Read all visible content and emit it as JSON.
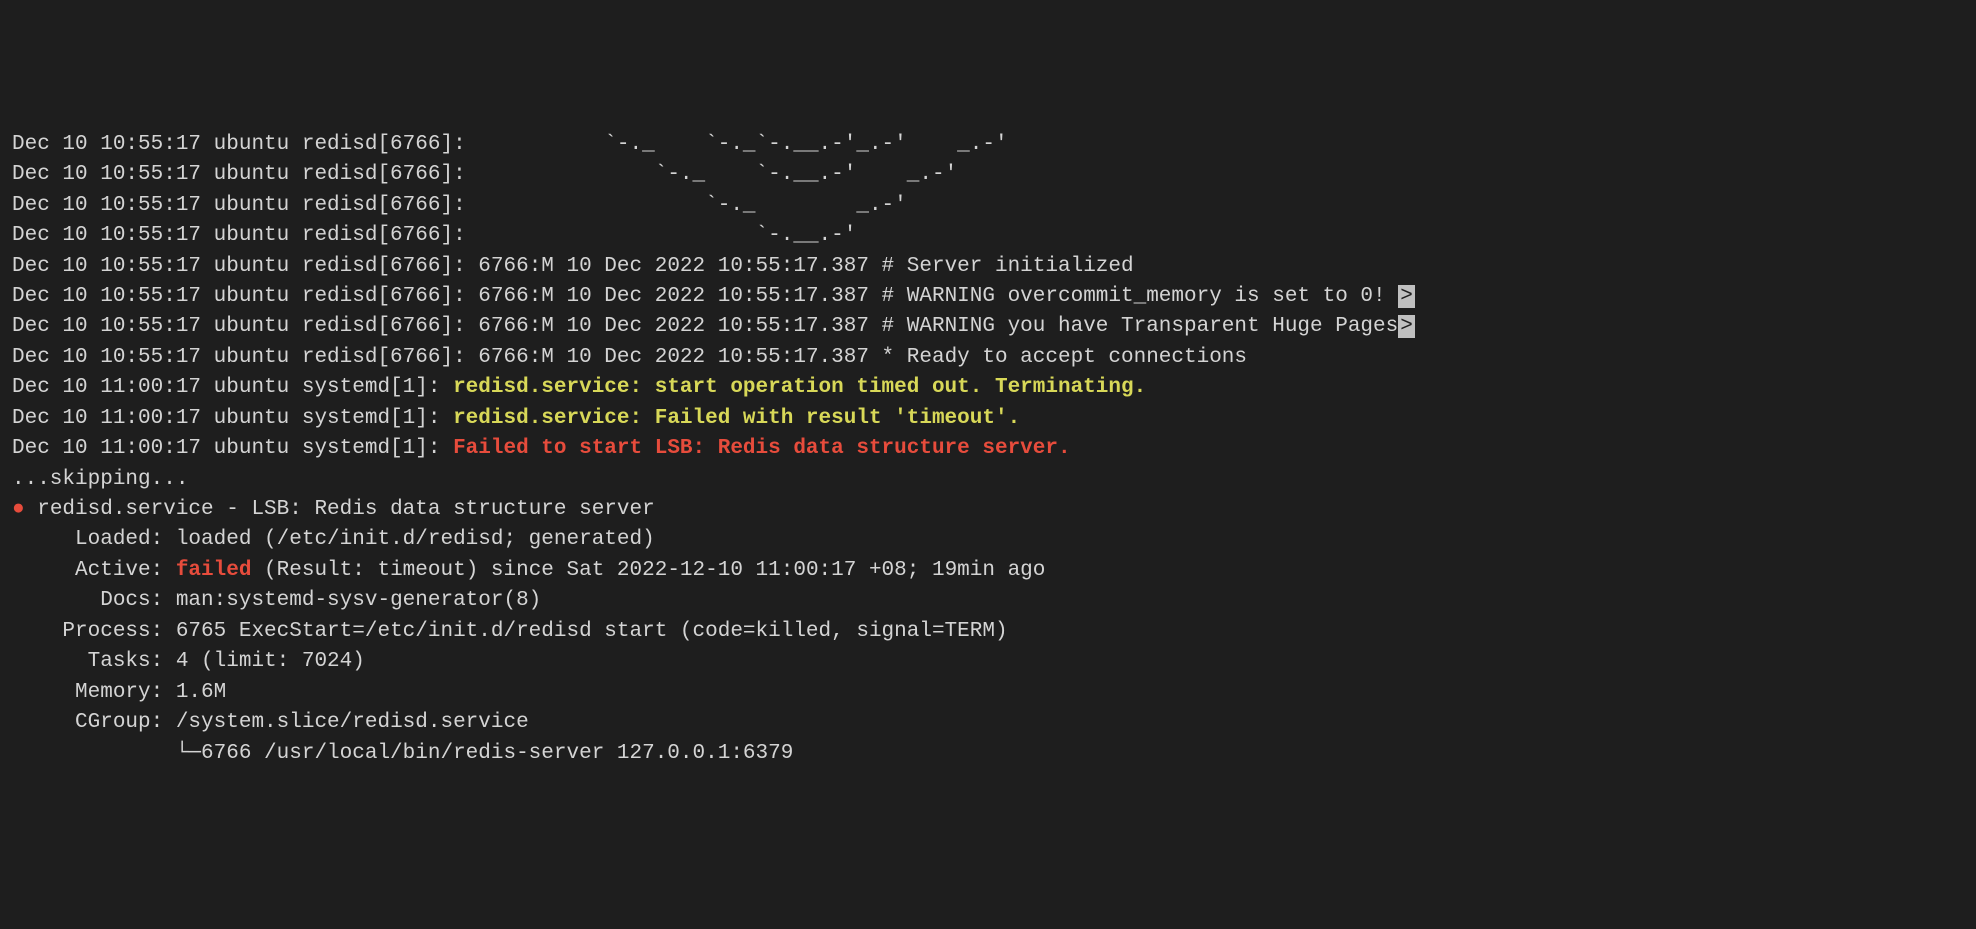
{
  "log": {
    "lines": [
      {
        "prefix": "Dec 10 10:55:17 ubuntu redisd[6766]:",
        "msg": "           `-._    `-._`-.__.-'_.-'    _.-'"
      },
      {
        "prefix": "Dec 10 10:55:17 ubuntu redisd[6766]:",
        "msg": "               `-._    `-.__.-'    _.-'"
      },
      {
        "prefix": "Dec 10 10:55:17 ubuntu redisd[6766]:",
        "msg": "                   `-._        _.-'"
      },
      {
        "prefix": "Dec 10 10:55:17 ubuntu redisd[6766]:",
        "msg": "                       `-.__.-'"
      },
      {
        "prefix": "Dec 10 10:55:17 ubuntu redisd[6766]:",
        "msg": " 6766:M 10 Dec 2022 10:55:17.387 # Server initialized"
      },
      {
        "prefix": "Dec 10 10:55:17 ubuntu redisd[6766]:",
        "msg": " 6766:M 10 Dec 2022 10:55:17.387 # WARNING overcommit_memory is set to 0! ",
        "scroll": ">"
      },
      {
        "prefix": "Dec 10 10:55:17 ubuntu redisd[6766]:",
        "msg": " 6766:M 10 Dec 2022 10:55:17.387 # WARNING you have Transparent Huge Pages",
        "scroll": ">"
      },
      {
        "prefix": "Dec 10 10:55:17 ubuntu redisd[6766]:",
        "msg": " 6766:M 10 Dec 2022 10:55:17.387 * Ready to accept connections"
      },
      {
        "prefix": "Dec 10 11:00:17 ubuntu systemd[1]: ",
        "highlight": "redisd.service: start operation timed out. Terminating.",
        "hclass": "yellow"
      },
      {
        "prefix": "Dec 10 11:00:17 ubuntu systemd[1]: ",
        "highlight": "redisd.service: Failed with result 'timeout'.",
        "hclass": "yellow"
      },
      {
        "prefix": "Dec 10 11:00:17 ubuntu systemd[1]: ",
        "highlight": "Failed to start LSB: Redis data structure server.",
        "hclass": "red"
      }
    ],
    "skipping": "...skipping..."
  },
  "status": {
    "bullet": "●",
    "header": " redisd.service - LSB: Redis data structure server",
    "loaded_label": "     Loaded: ",
    "loaded_value": "loaded (/etc/init.d/redisd; generated)",
    "active_label": "     Active: ",
    "active_state": "failed",
    "active_rest": " (Result: timeout) since Sat 2022-12-10 11:00:17 +08; 19min ago",
    "docs_label": "       Docs: ",
    "docs_value": "man:systemd-sysv-generator(8)",
    "process_label": "    Process: ",
    "process_value": "6765 ExecStart=/etc/init.d/redisd start (code=killed, signal=TERM)",
    "tasks_label": "      Tasks: ",
    "tasks_value": "4 (limit: 7024)",
    "memory_label": "     Memory: ",
    "memory_value": "1.6M",
    "cgroup_label": "     CGroup: ",
    "cgroup_value": "/system.slice/redisd.service",
    "cgroup_child": "             └─6766 /usr/local/bin/redis-server 127.0.0.1:6379"
  }
}
